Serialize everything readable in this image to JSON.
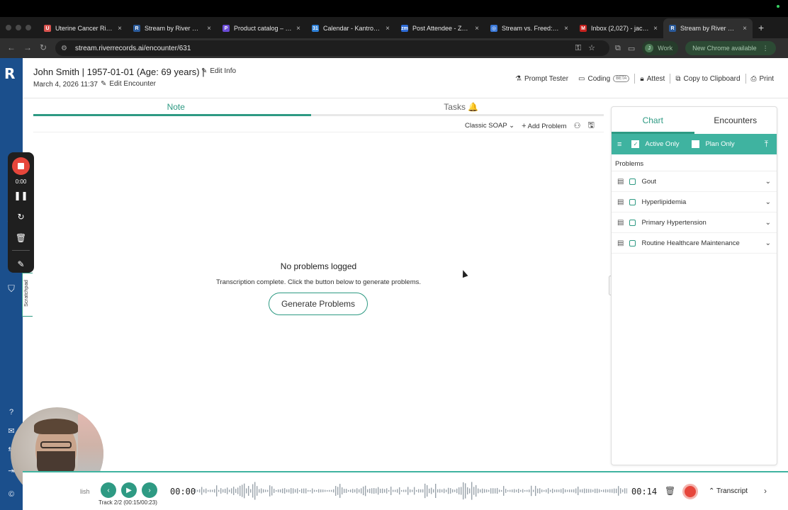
{
  "browser": {
    "tabs": [
      {
        "label": "Uterine Cancer Risk A",
        "fav": "U",
        "color": "#d9534f"
      },
      {
        "label": "Stream by River Reco",
        "fav": "R",
        "color": "#2a5a9a"
      },
      {
        "label": "Product catalog – Riv",
        "fav": "P",
        "color": "#6a4bd6"
      },
      {
        "label": "Calendar - Kantrowitz",
        "fav": "31",
        "color": "#2d7fd6"
      },
      {
        "label": "Post Attendee - Zoom",
        "fav": "zm",
        "color": "#2d6bd6"
      },
      {
        "label": "Stream vs. Freed: Uni",
        "fav": "◎",
        "color": "#3a78d8"
      },
      {
        "label": "Inbox (2,027) - jacob",
        "fav": "M",
        "color": "#c5221f"
      },
      {
        "label": "Stream by River Reco",
        "fav": "R",
        "color": "#2a5a9a"
      }
    ],
    "url": "stream.riverrecords.ai/encounter/631",
    "profile_label": "Work",
    "profile_initial": "J",
    "update_label": "New Chrome available"
  },
  "header": {
    "patient": "John Smith | 1957-01-01 (Age: 69 years) |",
    "edit_info": "Edit Info",
    "date": "March 4, 2026 11:37",
    "edit_encounter": "Edit Encounter",
    "prompt_tester": "Prompt Tester",
    "coding": "Coding",
    "beta": "BETA",
    "attest": "Attest",
    "copy": "Copy to Clipboard",
    "print": "Print"
  },
  "note": {
    "tab_note": "Note",
    "tab_tasks": "Tasks 🔔",
    "template": "Classic SOAP",
    "add_problem": "Add Problem",
    "empty_title": "No problems logged",
    "empty_sub": "Transcription complete. Click the button below to generate problems.",
    "generate": "Generate Problems"
  },
  "panel": {
    "tab_chart": "Chart",
    "tab_encounters": "Encounters",
    "active_only": "Active Only",
    "plan_only": "Plan Only",
    "problems_header": "Problems",
    "problems": [
      "Gout",
      "Hyperlipidemia",
      "Primary Hypertension",
      "Routine Healthcare Maintenance"
    ]
  },
  "recorder": {
    "time": "0:00",
    "scratchpad": "Scratchpad"
  },
  "audio": {
    "partial_text": "lish",
    "track": "Track 2/2 (00:15/00:23)",
    "time_current": "00:00",
    "time_total": "00:14",
    "transcript": "Transcript"
  },
  "colors": {
    "accent": "#2e9a83",
    "accent_light": "#3fb3a0",
    "nav": "#1b4f8c",
    "record": "#e6463b"
  }
}
